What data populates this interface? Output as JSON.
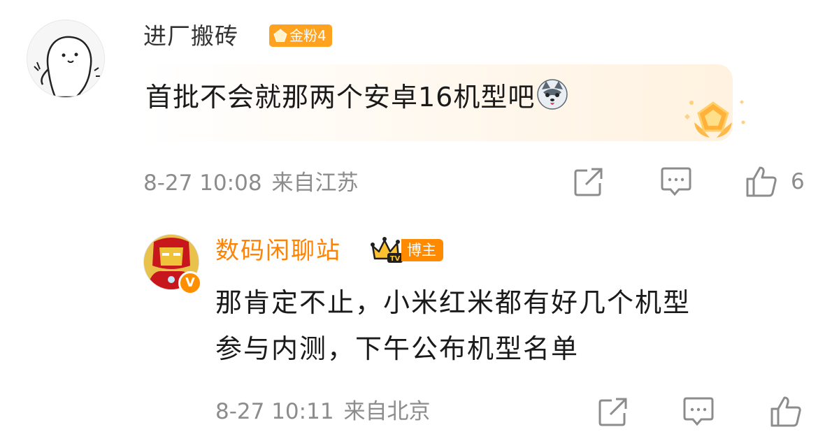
{
  "comment1": {
    "username": "进厂搬砖",
    "fan_badge": {
      "label": "金粉4",
      "color": "#ffa21f"
    },
    "text": "首批不会就那两个安卓16机型吧",
    "emoji": "husky-dog-emoji",
    "time": "8-27 10:08",
    "location": "来自江苏",
    "like_count": "6"
  },
  "comment2": {
    "username": "数码闲聊站",
    "username_color": "#ff8200",
    "badge_label": "博主",
    "text_line1": "那肯定不止，小米红米都有好几个机型",
    "text_line2": "参与内测，下午公布机型名单",
    "time": "8-27 10:11",
    "location": "来自北京"
  },
  "icons": {
    "share": "share-icon",
    "comment": "comment-icon",
    "like": "thumbs-up-icon"
  }
}
